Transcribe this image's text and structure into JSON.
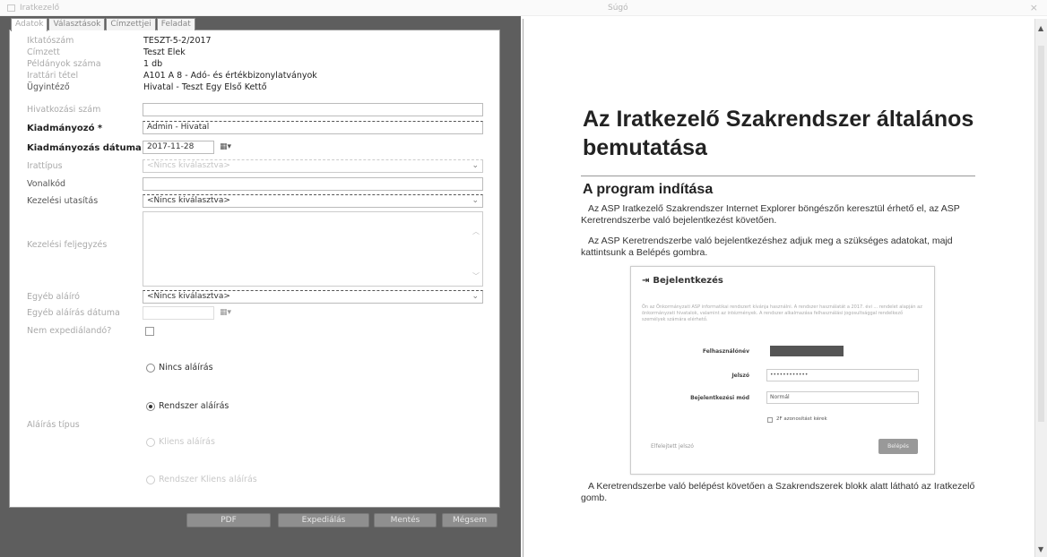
{
  "window": {
    "app_title": "Iratkezelő",
    "center_title": "Súgó",
    "close": "×"
  },
  "tabs": [
    "Adatok",
    "Választások",
    "Címzettjei",
    "Feladat"
  ],
  "form": {
    "rows": [
      {
        "label": "Iktatószám",
        "value": "TESZT-5-2/2017"
      },
      {
        "label": "Címzett",
        "value": "Teszt Elek"
      },
      {
        "label": "Példányok száma",
        "value": "1 db"
      },
      {
        "label": "Irattári tétel",
        "value": "A101 A 8 - Adó- és értékbizonylatványok"
      },
      {
        "label": "Ügyintéző",
        "value": "Hivatal - Teszt Egy Első Kettő"
      }
    ],
    "hivatkozasi_szam_label": "Hivatkozási szám",
    "kiadmanyozo_label": "Kiadmányozó *",
    "kiadmanyozo_value": "Admin - Hivatal",
    "kiadmanyozas_datuma_label": "Kiadmányozás dátuma *",
    "kiadmanyozas_datuma_value": "2017-11-28",
    "irattipus_label": "Irattípus",
    "irattipus_placeholder": "<Nincs kiválasztva>",
    "vonalkod_label": "Vonalkód",
    "kezelesi_utasitas_label": "Kezelési utasítás",
    "kezelesi_utasitas_value": "<Nincs kiválasztva>",
    "kezelesi_feljegyzes_label": "Kezelési feljegyzés",
    "egyeb_alairo_label": "Egyéb aláíró",
    "egyeb_alairo_value": "<Nincs kiválasztva>",
    "egyeb_alairas_datuma_label": "Egyéb aláírás dátuma",
    "nem_expedialando_label": "Nem expediálandó?",
    "alairas_tipus_label": "Aláírás típus",
    "radios": [
      {
        "label": "Nincs aláírás",
        "checked": false,
        "enabled": true
      },
      {
        "label": "Rendszer aláírás",
        "checked": true,
        "enabled": true
      },
      {
        "label": "Kliens aláírás",
        "checked": false,
        "enabled": false
      },
      {
        "label": "Rendszer Kliens aláírás",
        "checked": false,
        "enabled": false
      }
    ],
    "calendar_icon": "▦▾"
  },
  "buttons": [
    "PDF",
    "Expediálás",
    "Mentés",
    "Mégsem"
  ],
  "document": {
    "title": "Az Iratkezelő Szakrendszer általános bemutatása",
    "h2": "A program indítása",
    "p1": "Az ASP Iratkezelő Szakrendszer Internet Explorer böngészőn keresztül érhető el, az ASP Keretrendszerbe való bejelentkezést követően.",
    "p2": "Az ASP Keretrendszerbe való bejelentkezéshez adjuk meg a szükséges adatokat, majd kattintsunk a Belépés gombra.",
    "p3": "A Keretrendszerbe való belépést követően a Szakrendszerek blokk alatt látható az Iratkezelő gomb.",
    "figure": {
      "title": "Bejelentkezés",
      "intro": "Ön az Önkormányzati ASP informatikai rendszert kívánja használni. A rendszer használatát a 2017. évi ... rendelet alapján az önkormányzati hivatalok, valamint az intézmények. A rendszer alkalmazása felhasználási jogosultsággal rendelkező személyek számára elérhető.",
      "username_label": "Felhasználónév",
      "password_label": "Jelszó",
      "password_value": "••••••••••••",
      "method_label": "Bejelentkezési mód",
      "method_value": "Normál",
      "remember_label": "2F azonosítást kérek",
      "forgot_link": "Elfelejtett jelszó",
      "login_button": "Belépés"
    }
  }
}
